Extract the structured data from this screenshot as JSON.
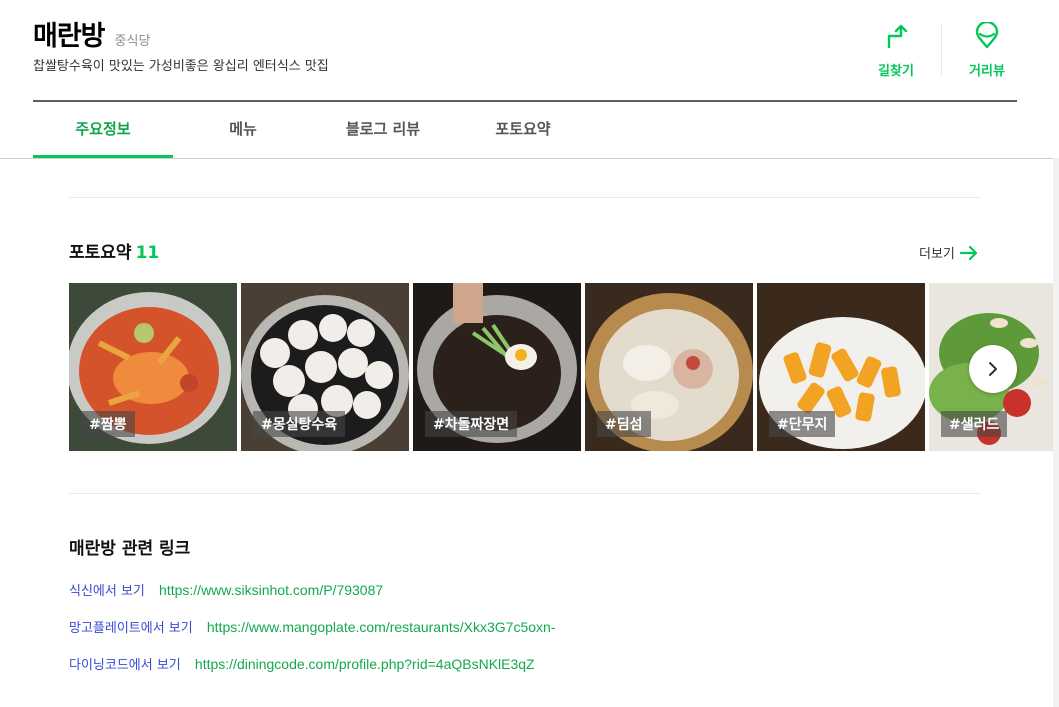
{
  "header": {
    "name": "매란방",
    "category": "중식당",
    "tagline": "찹쌀탕수육이 맛있는 가성비좋은 왕십리 엔터식스 맛집",
    "actions": [
      {
        "label": "길찾기",
        "icon": "route-arrow-icon"
      },
      {
        "label": "거리뷰",
        "icon": "street-view-pin-icon"
      }
    ]
  },
  "tabs": [
    {
      "label": "주요정보",
      "active": true
    },
    {
      "label": "메뉴",
      "active": false
    },
    {
      "label": "블로그 리뷰",
      "active": false
    },
    {
      "label": "포토요약",
      "active": false
    }
  ],
  "photo_summary": {
    "title": "포토요약",
    "count": "11",
    "more_label": "더보기",
    "photos": [
      {
        "tag": "#짬뽕"
      },
      {
        "tag": "#몽실탕수육"
      },
      {
        "tag": "#차돌짜장면"
      },
      {
        "tag": "#딤섬"
      },
      {
        "tag": "#단무지"
      },
      {
        "tag": "#샐러드"
      }
    ]
  },
  "related_links": {
    "title": "매란방 관련 링크",
    "items": [
      {
        "label": "식신에서 보기",
        "url": "https://www.siksinhot.com/P/793087"
      },
      {
        "label": "망고플레이트에서 보기",
        "url": "https://www.mangoplate.com/restaurants/Xkx3G7c5oxn-"
      },
      {
        "label": "다이닝코드에서 보기",
        "url": "https://diningcode.com/profile.php?rid=4aQBsNKlE3qZ"
      }
    ]
  },
  "colors": {
    "accent": "#03c75a",
    "link_label": "#3849d6",
    "link_url": "#13a84f"
  }
}
